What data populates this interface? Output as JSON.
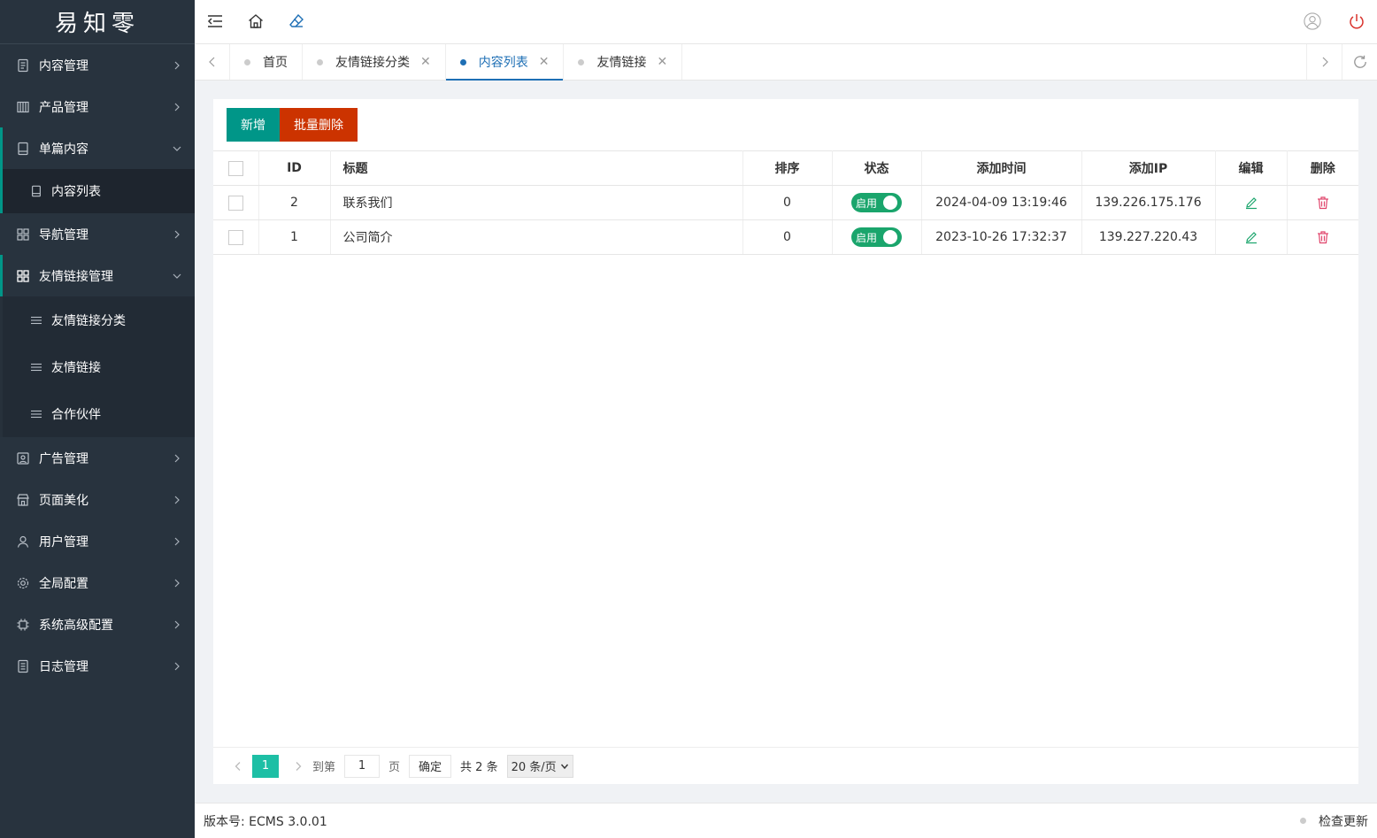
{
  "brand": {
    "logo_text": "易知零"
  },
  "sidebar": {
    "items": [
      {
        "label": "内容管理"
      },
      {
        "label": "产品管理"
      },
      {
        "label": "单篇内容",
        "children": [
          {
            "label": "内容列表"
          }
        ]
      },
      {
        "label": "导航管理"
      },
      {
        "label": "友情链接管理",
        "children": [
          {
            "label": "友情链接分类"
          },
          {
            "label": "友情链接"
          },
          {
            "label": "合作伙伴"
          }
        ]
      },
      {
        "label": "广告管理"
      },
      {
        "label": "页面美化"
      },
      {
        "label": "用户管理"
      },
      {
        "label": "全局配置"
      },
      {
        "label": "系统高级配置"
      },
      {
        "label": "日志管理"
      }
    ]
  },
  "tabs": [
    {
      "label": "首页",
      "closable": false
    },
    {
      "label": "友情链接分类",
      "closable": true
    },
    {
      "label": "内容列表",
      "closable": true,
      "active": true
    },
    {
      "label": "友情链接",
      "closable": true
    }
  ],
  "toolbar": {
    "add_label": "新增",
    "batch_delete_label": "批量删除"
  },
  "table": {
    "columns": [
      "ID",
      "标题",
      "排序",
      "状态",
      "添加时间",
      "添加IP",
      "编辑",
      "删除"
    ],
    "rows": [
      {
        "id": "2",
        "title": "联系我们",
        "sort": "0",
        "status": "启用",
        "time": "2024-04-09 13:19:46",
        "ip": "139.226.175.176"
      },
      {
        "id": "1",
        "title": "公司简介",
        "sort": "0",
        "status": "启用",
        "time": "2023-10-26 17:32:37",
        "ip": "139.227.220.43"
      }
    ]
  },
  "pager": {
    "current": "1",
    "goto_label": "到第",
    "goto_value": "1",
    "page_unit": "页",
    "confirm_label": "确定",
    "total_text": "共 2 条",
    "page_size": "20 条/页"
  },
  "footer": {
    "version": "版本号: ECMS 3.0.01",
    "check_update": "检查更新"
  },
  "colors": {
    "sidebar_bg": "#28333e",
    "accent": "#009688",
    "danger": "#cc3300",
    "tab_active": "#1e6fb5",
    "switch_on": "#1aa56c"
  }
}
